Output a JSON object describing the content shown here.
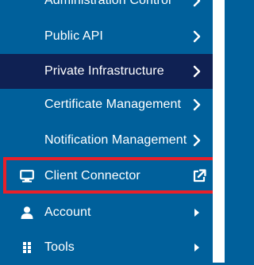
{
  "sidebar": {
    "items": [
      {
        "label": "Administration Control",
        "icon": "chevron-right-icon"
      },
      {
        "label": "Public API",
        "icon": "chevron-right-icon"
      },
      {
        "label": "Private Infrastructure",
        "icon": "chevron-right-icon",
        "active": true
      },
      {
        "label": "Certificate Management",
        "icon": "chevron-right-icon"
      },
      {
        "label": "Notification Management",
        "icon": "chevron-right-icon"
      },
      {
        "label": "Client Connector",
        "icon": "monitor-icon",
        "trailing_icon": "external-link-icon",
        "highlighted": true
      },
      {
        "label": "Account",
        "icon": "user-icon",
        "trailing_icon": "caret-right-icon"
      },
      {
        "label": "Tools",
        "icon": "grid-icon",
        "trailing_icon": "caret-right-icon"
      }
    ]
  },
  "colors": {
    "background": "#00609b",
    "active_background": "#0f2153",
    "text": "#ffffff",
    "highlight_border": "#e8202a"
  }
}
